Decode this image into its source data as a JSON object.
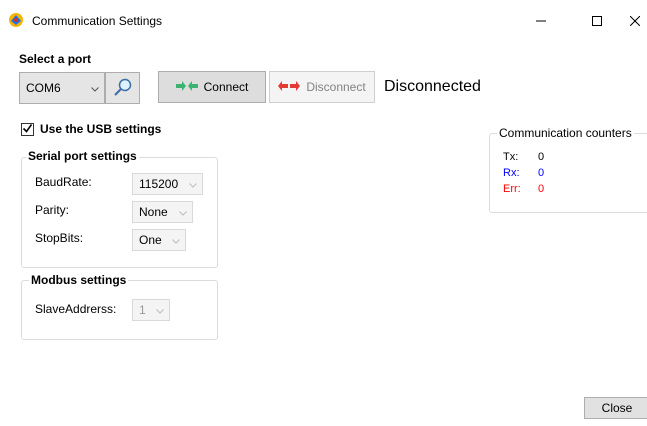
{
  "window": {
    "title": "Communication Settings",
    "icon": "app-icon",
    "controls": {
      "minimize": "minimize-icon",
      "maximize": "maximize-icon",
      "close": "close-icon"
    }
  },
  "port": {
    "section_label": "Select a port",
    "selected_port": "COM6",
    "search_icon": "search-icon",
    "connect_label": "Connect",
    "connect_icon": "connect-arrows-icon",
    "disconnect_label": "Disconnect",
    "disconnect_icon": "disconnect-arrows-icon",
    "status": "Disconnected"
  },
  "usb": {
    "label": "Use the USB settings",
    "checked": true
  },
  "serial": {
    "title": "Serial port settings",
    "fields": [
      {
        "label": "BaudRate:",
        "value": "115200"
      },
      {
        "label": "Parity:",
        "value": "None"
      },
      {
        "label": "StopBits:",
        "value": "One"
      }
    ]
  },
  "modbus": {
    "title": "Modbus settings",
    "slave_label": "SlaveAddrerss:",
    "slave_value": "1"
  },
  "counters": {
    "title": "Communication counters",
    "items": [
      {
        "label": "Tx:",
        "value": "0",
        "color": "#000000"
      },
      {
        "label": "Rx:",
        "value": "0",
        "color": "#0000ff"
      },
      {
        "label": "Err:",
        "value": "0",
        "color": "#ff0000"
      }
    ]
  },
  "footer": {
    "close_label": "Close"
  }
}
